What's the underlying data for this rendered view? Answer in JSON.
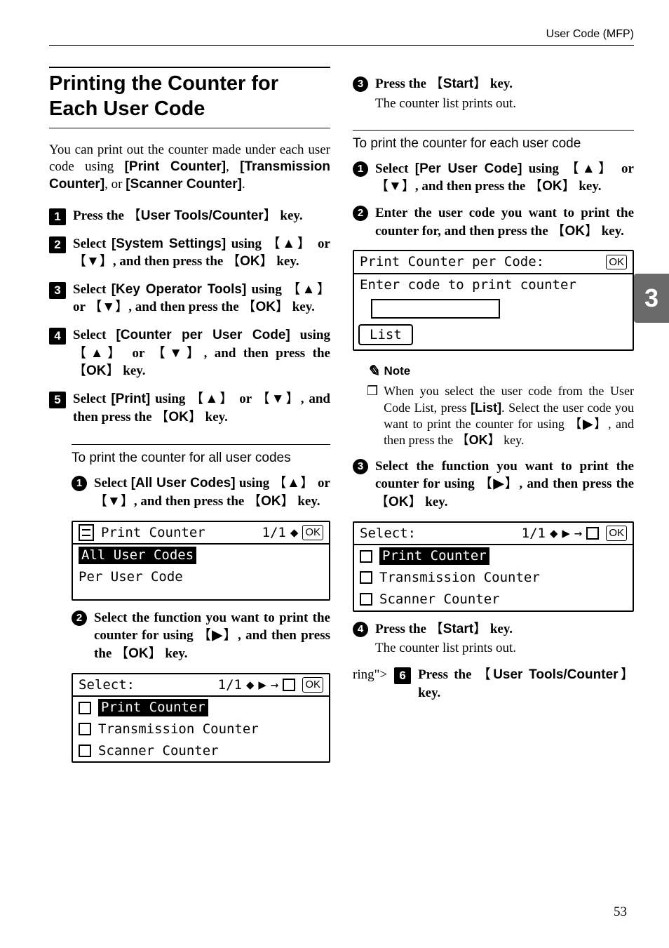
{
  "running_head": "User Code (MFP)",
  "chapter_tab": "3",
  "page_number": "53",
  "section_title": "Printing the Counter for Each User Code",
  "intro_parts": {
    "a": "You can print out the counter made under each user code using ",
    "b": "[Print Counter]",
    "c": ", ",
    "d": "[Transmission Counter]",
    "e": ", or ",
    "f": "[Scanner Counter]",
    "g": "."
  },
  "step1": {
    "a": "Press the ",
    "key": "User Tools/Counter",
    "b": " key."
  },
  "step2": {
    "a": "Select ",
    "b": "[System Settings]",
    "c": " using ",
    "up": "▲",
    "d": " or ",
    "down": "▼",
    "e": ", and then press the ",
    "ok": "OK",
    "f": " key."
  },
  "step3": {
    "a": "Select ",
    "b": "[Key Operator Tools]",
    "c": " using ",
    "up": "▲",
    "d": " or ",
    "down": "▼",
    "e": ", and then press the ",
    "ok": "OK",
    "f": " key."
  },
  "step4": {
    "a": "Select ",
    "b": "[Counter per User Code]",
    "c": " using ",
    "up": "▲",
    "d": " or ",
    "down": "▼",
    "e": ", and then press the ",
    "ok": "OK",
    "f": " key."
  },
  "step5": {
    "a": "Select ",
    "b": "[Print]",
    "c": " using ",
    "up": "▲",
    "d": " or ",
    "down": "▼",
    "e": ", and then press the ",
    "ok": "OK",
    "f": " key."
  },
  "groupA_head": "To print the counter for all user codes",
  "subA1": {
    "a": "Select ",
    "b": "[All User Codes]",
    "c": " using ",
    "up": "▲",
    "d": " or ",
    "down": "▼",
    "e": ", and then press the ",
    "ok": "OK",
    "f": " key."
  },
  "lcd1": {
    "title_a": "Print Counter",
    "title_b": "1/1",
    "row_hl": "All User Codes",
    "row2": "Per User Code"
  },
  "subA2": {
    "a": "Select the function you want to print the counter for using ",
    "right": "▶",
    "b": ", and then press the ",
    "ok": "OK",
    "c": " key."
  },
  "lcd2": {
    "title_a": "Select:",
    "title_b": "1/1",
    "row_hl": "Print Counter",
    "row2": "Transmission Counter",
    "row3": "Scanner Counter"
  },
  "subA3": {
    "a": "Press the ",
    "key": "Start",
    "b": " key."
  },
  "subA3_out": "The counter list prints out.",
  "groupB_head": "To print the counter for each user code",
  "subB1": {
    "a": "Select ",
    "b": "[Per User Code]",
    "c": " using ",
    "up": "▲",
    "d": " or ",
    "down": "▼",
    "e": ", and then press the ",
    "ok": "OK",
    "f": " key."
  },
  "subB2": {
    "a": "Enter the user code you want to print the counter for, and then press the ",
    "ok": "OK",
    "b": " key."
  },
  "lcd3": {
    "title": "Print Counter per Code:",
    "row1": "Enter code to print counter",
    "btn": "List"
  },
  "note_head": "Note",
  "note_text": {
    "a": "When you select the user code from the User Code List, press ",
    "b": "[List]",
    "c": ". Select the user code you want to print the counter for using ",
    "right": "▶",
    "d": ", and then press the ",
    "ok": "OK",
    "e": " key."
  },
  "subB3": {
    "a": "Select the function you want to print the counter for using ",
    "right": "▶",
    "b": ", and then press the ",
    "ok": "OK",
    "c": " key."
  },
  "lcd4": {
    "title_a": "Select:",
    "title_b": "1/1",
    "row_hl": "Print Counter",
    "row2": "Transmission Counter",
    "row3": "Scanner Counter"
  },
  "subB4": {
    "a": "Press the ",
    "key": "Start",
    "b": " key."
  },
  "subB4_out": "The counter list prints out.",
  "step6": {
    "a": "Press the ",
    "key": "User Tools/Counter",
    "b": " key."
  },
  "glyph_ok": "OK",
  "glyph_updown": "◆",
  "glyph_play": "▶",
  "glyph_arrowmove": "→",
  "glyph_check": "✓"
}
